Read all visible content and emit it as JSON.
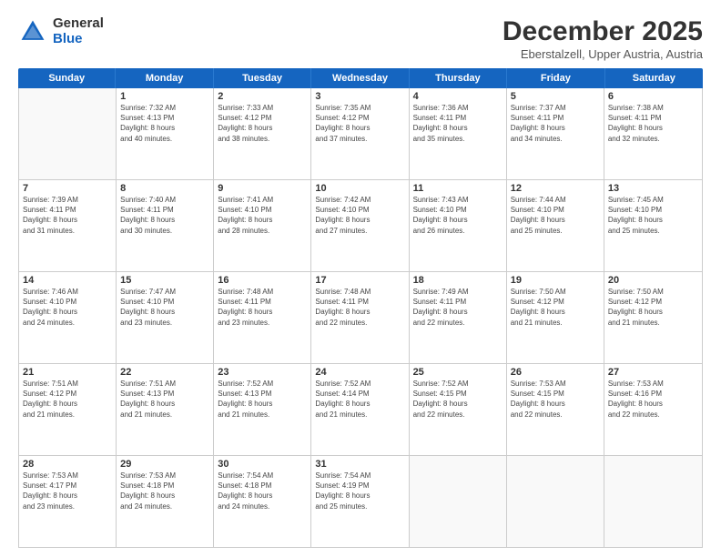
{
  "logo": {
    "general": "General",
    "blue": "Blue"
  },
  "title": "December 2025",
  "location": "Eberstalzell, Upper Austria, Austria",
  "header_days": [
    "Sunday",
    "Monday",
    "Tuesday",
    "Wednesday",
    "Thursday",
    "Friday",
    "Saturday"
  ],
  "weeks": [
    [
      {
        "day": "",
        "content": ""
      },
      {
        "day": "1",
        "content": "Sunrise: 7:32 AM\nSunset: 4:13 PM\nDaylight: 8 hours\nand 40 minutes."
      },
      {
        "day": "2",
        "content": "Sunrise: 7:33 AM\nSunset: 4:12 PM\nDaylight: 8 hours\nand 38 minutes."
      },
      {
        "day": "3",
        "content": "Sunrise: 7:35 AM\nSunset: 4:12 PM\nDaylight: 8 hours\nand 37 minutes."
      },
      {
        "day": "4",
        "content": "Sunrise: 7:36 AM\nSunset: 4:11 PM\nDaylight: 8 hours\nand 35 minutes."
      },
      {
        "day": "5",
        "content": "Sunrise: 7:37 AM\nSunset: 4:11 PM\nDaylight: 8 hours\nand 34 minutes."
      },
      {
        "day": "6",
        "content": "Sunrise: 7:38 AM\nSunset: 4:11 PM\nDaylight: 8 hours\nand 32 minutes."
      }
    ],
    [
      {
        "day": "7",
        "content": "Sunrise: 7:39 AM\nSunset: 4:11 PM\nDaylight: 8 hours\nand 31 minutes."
      },
      {
        "day": "8",
        "content": "Sunrise: 7:40 AM\nSunset: 4:11 PM\nDaylight: 8 hours\nand 30 minutes."
      },
      {
        "day": "9",
        "content": "Sunrise: 7:41 AM\nSunset: 4:10 PM\nDaylight: 8 hours\nand 28 minutes."
      },
      {
        "day": "10",
        "content": "Sunrise: 7:42 AM\nSunset: 4:10 PM\nDaylight: 8 hours\nand 27 minutes."
      },
      {
        "day": "11",
        "content": "Sunrise: 7:43 AM\nSunset: 4:10 PM\nDaylight: 8 hours\nand 26 minutes."
      },
      {
        "day": "12",
        "content": "Sunrise: 7:44 AM\nSunset: 4:10 PM\nDaylight: 8 hours\nand 25 minutes."
      },
      {
        "day": "13",
        "content": "Sunrise: 7:45 AM\nSunset: 4:10 PM\nDaylight: 8 hours\nand 25 minutes."
      }
    ],
    [
      {
        "day": "14",
        "content": "Sunrise: 7:46 AM\nSunset: 4:10 PM\nDaylight: 8 hours\nand 24 minutes."
      },
      {
        "day": "15",
        "content": "Sunrise: 7:47 AM\nSunset: 4:10 PM\nDaylight: 8 hours\nand 23 minutes."
      },
      {
        "day": "16",
        "content": "Sunrise: 7:48 AM\nSunset: 4:11 PM\nDaylight: 8 hours\nand 23 minutes."
      },
      {
        "day": "17",
        "content": "Sunrise: 7:48 AM\nSunset: 4:11 PM\nDaylight: 8 hours\nand 22 minutes."
      },
      {
        "day": "18",
        "content": "Sunrise: 7:49 AM\nSunset: 4:11 PM\nDaylight: 8 hours\nand 22 minutes."
      },
      {
        "day": "19",
        "content": "Sunrise: 7:50 AM\nSunset: 4:12 PM\nDaylight: 8 hours\nand 21 minutes."
      },
      {
        "day": "20",
        "content": "Sunrise: 7:50 AM\nSunset: 4:12 PM\nDaylight: 8 hours\nand 21 minutes."
      }
    ],
    [
      {
        "day": "21",
        "content": "Sunrise: 7:51 AM\nSunset: 4:12 PM\nDaylight: 8 hours\nand 21 minutes."
      },
      {
        "day": "22",
        "content": "Sunrise: 7:51 AM\nSunset: 4:13 PM\nDaylight: 8 hours\nand 21 minutes."
      },
      {
        "day": "23",
        "content": "Sunrise: 7:52 AM\nSunset: 4:13 PM\nDaylight: 8 hours\nand 21 minutes."
      },
      {
        "day": "24",
        "content": "Sunrise: 7:52 AM\nSunset: 4:14 PM\nDaylight: 8 hours\nand 21 minutes."
      },
      {
        "day": "25",
        "content": "Sunrise: 7:52 AM\nSunset: 4:15 PM\nDaylight: 8 hours\nand 22 minutes."
      },
      {
        "day": "26",
        "content": "Sunrise: 7:53 AM\nSunset: 4:15 PM\nDaylight: 8 hours\nand 22 minutes."
      },
      {
        "day": "27",
        "content": "Sunrise: 7:53 AM\nSunset: 4:16 PM\nDaylight: 8 hours\nand 22 minutes."
      }
    ],
    [
      {
        "day": "28",
        "content": "Sunrise: 7:53 AM\nSunset: 4:17 PM\nDaylight: 8 hours\nand 23 minutes."
      },
      {
        "day": "29",
        "content": "Sunrise: 7:53 AM\nSunset: 4:18 PM\nDaylight: 8 hours\nand 24 minutes."
      },
      {
        "day": "30",
        "content": "Sunrise: 7:54 AM\nSunset: 4:18 PM\nDaylight: 8 hours\nand 24 minutes."
      },
      {
        "day": "31",
        "content": "Sunrise: 7:54 AM\nSunset: 4:19 PM\nDaylight: 8 hours\nand 25 minutes."
      },
      {
        "day": "",
        "content": ""
      },
      {
        "day": "",
        "content": ""
      },
      {
        "day": "",
        "content": ""
      }
    ]
  ]
}
